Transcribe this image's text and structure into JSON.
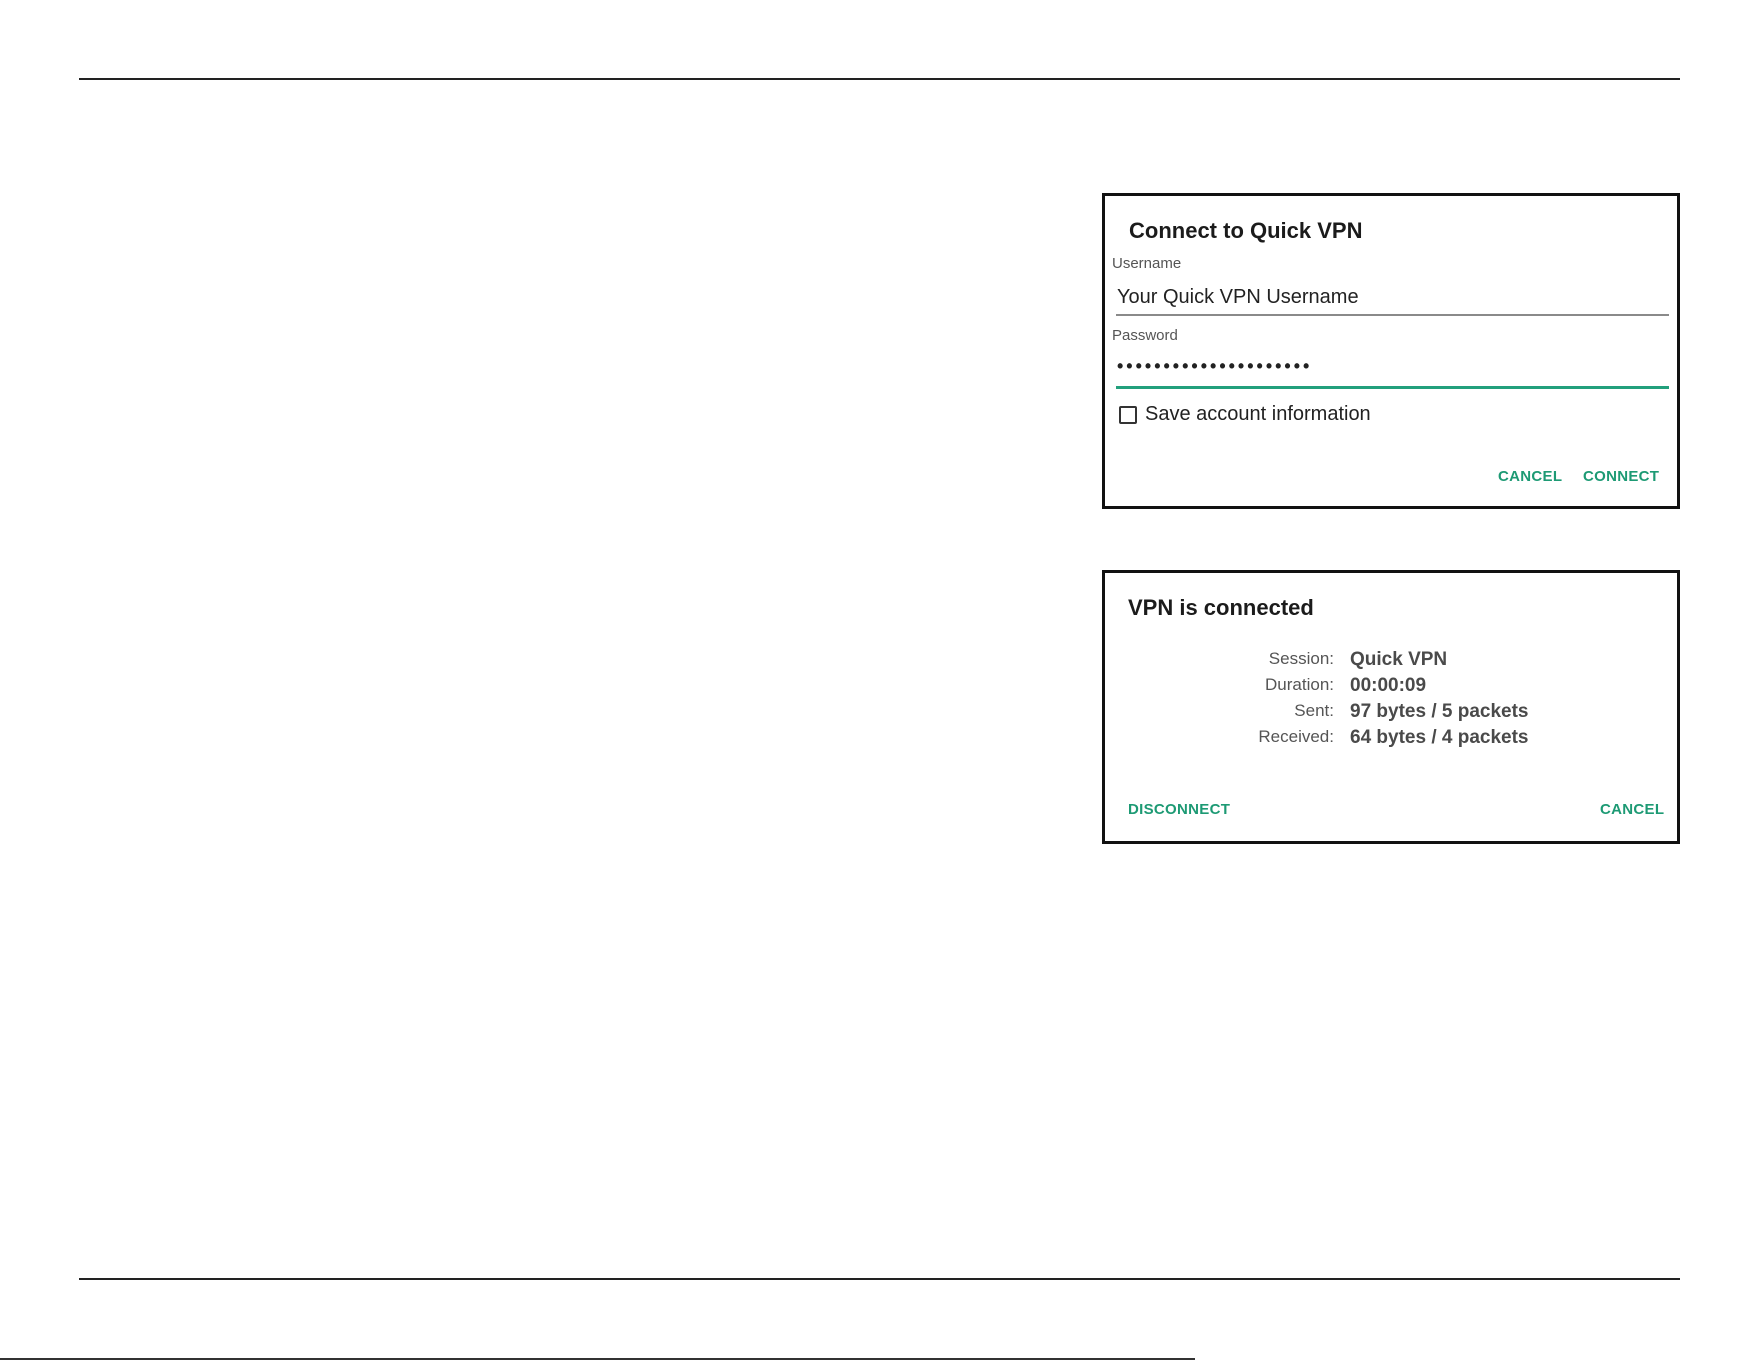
{
  "connect_dialog": {
    "title": "Connect to Quick VPN",
    "username_label": "Username",
    "username_value": "Your Quick VPN Username",
    "password_label": "Password",
    "password_value": "•••••••••••••••••••••",
    "save_label": "Save account information",
    "save_checked": false,
    "cancel_label": "CANCEL",
    "connect_label": "CONNECT"
  },
  "status_dialog": {
    "title": "VPN is connected",
    "rows": [
      {
        "label": "Session:",
        "value": "Quick VPN"
      },
      {
        "label": "Duration:",
        "value": "00:00:09"
      },
      {
        "label": "Sent:",
        "value": "97 bytes / 5 packets"
      },
      {
        "label": "Received:",
        "value": "64 bytes / 4 packets"
      }
    ],
    "disconnect_label": "DISCONNECT",
    "cancel_label": "CANCEL"
  },
  "colors": {
    "accent": "#1d9a74",
    "underline_active": "#22a07c"
  }
}
